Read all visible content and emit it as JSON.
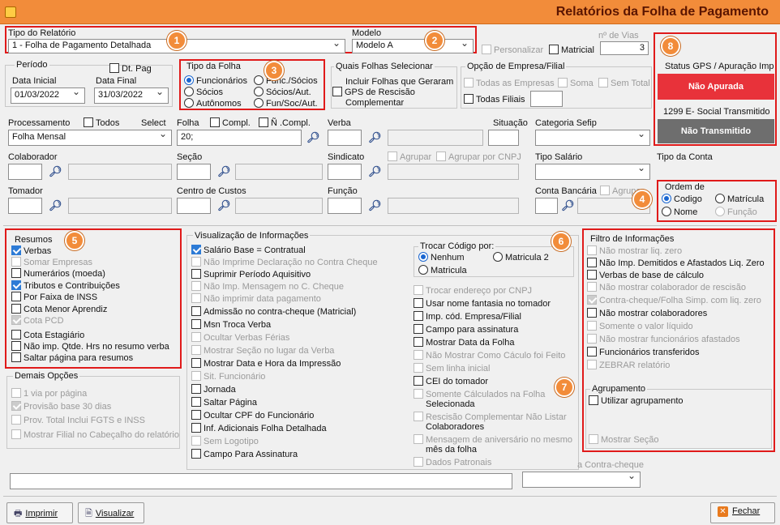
{
  "app": {
    "title": "Relatórios da Folha de Pagamento"
  },
  "tipo_relatorio": {
    "label": "Tipo do Relatório",
    "value": "1 - Folha de Pagamento Detalhada"
  },
  "modelo": {
    "label": "Modelo",
    "value": "Modelo A"
  },
  "personalizar": "Personalizar",
  "matricial": "Matricial",
  "vias": {
    "label": "nº de Vias",
    "value": "3"
  },
  "periodo": {
    "label": "Período",
    "dt_pag": "Dt. Pag",
    "data_inicial_label": "Data Inicial",
    "data_final_label": "Data Final",
    "data_inicial": "01/03/2022",
    "data_final": "31/03/2022"
  },
  "tipo_folha": {
    "label": "Tipo da Folha",
    "options": [
      "Funcionários",
      "Func./Sócios",
      "Sócios",
      "Sócios/Aut.",
      "Autônomos",
      "Fun/Soc/Aut."
    ]
  },
  "quais_folhas": {
    "label": "Quais Folhas Selecionar",
    "incluir": "Incluir Folhas que Geraram",
    "gps": "GPS de Rescisão",
    "complementar": "Complementar"
  },
  "opcao_empresa": {
    "label": "Opção de Empresa/Filial",
    "todas_empresas": "Todas as Empresas",
    "soma": "Soma",
    "sem_total": "Sem Total",
    "todas_filiais": "Todas Filiais"
  },
  "status": {
    "gps_label": "Status GPS / Apuração Imp",
    "gps_value": "Não Apurada",
    "esocial_label": "1299 E- Social Transmitido",
    "esocial_value": "Não Transmitido",
    "gps_color": "#e8323a",
    "esocial_color": "#6e6e6e"
  },
  "processamento": {
    "label": "Processamento",
    "todos": "Todos",
    "select": "Select",
    "value": "Folha Mensal"
  },
  "folha": {
    "label": "Folha",
    "compl": "Compl.",
    "n_compl": "Ñ .Compl.",
    "value": "20;"
  },
  "verba_label": "Verba",
  "situacao_label": "Situação",
  "categoria_sefip_label": "Categoria Sefip",
  "colaborador_label": "Colaborador",
  "secao_label": "Seção",
  "sindicato_label": "Sindicato",
  "agrupar": "Agrupar",
  "agrupar_cnpj": "Agrupar por CNPJ",
  "tipo_salario_label": "Tipo Salário",
  "tipo_conta_label": "Tipo da Conta",
  "tomador_label": "Tomador",
  "centro_custos_label": "Centro de Custos",
  "funcao_label": "Função",
  "conta_bancaria_label": "Conta Bancária",
  "agrupar2": "Agrupar",
  "ordem": {
    "label": "Ordem de",
    "codigo": "Codigo",
    "matricula": "Matrícula",
    "nome": "Nome",
    "funcao": "Função"
  },
  "resumos": {
    "label": "Resumos",
    "items": [
      "Verbas",
      "Somar Empresas",
      "Numerários (moeda)",
      "Tributos e Contribuições",
      "Por Faixa de INSS",
      "Cota Menor Aprendiz",
      "Cota PCD",
      "Cota Estagiário",
      "Não imp. Qtde. Hrs no resumo verba",
      "Saltar página para resumos"
    ]
  },
  "demais": {
    "label": "Demais Opções",
    "items": [
      "1 via por página",
      "Provisão base 30 dias",
      "Prov. Total Inclui FGTS e INSS",
      "Mostrar Filial no Cabeçalho do relatório"
    ]
  },
  "visualizacao": {
    "label": "Visualização de Informações",
    "items": [
      "Salário Base = Contratual",
      "Não Imprime Declaração no Contra Cheque",
      "Suprimir Período Aquisitivo",
      "Não Imp. Mensagem no C. Cheque",
      "Não imprimir data pagamento",
      "Admissão no contra-cheque (Matricial)",
      "Msn Troca Verba",
      "Ocultar Verbas Férias",
      "Mostrar Seção no lugar da Verba",
      "Mostrar Data e Hora da Impressão",
      "Sit. Funcionário",
      "Jornada",
      "Saltar Página",
      "Ocultar CPF do Funcionário",
      "Inf. Adicionais Folha Detalhada",
      "Sem Logotipo",
      "Campo Para Assinatura"
    ]
  },
  "trocar": {
    "label": "Trocar Código por:",
    "nenhum": "Nenhum",
    "matricula2": "Matricula 2",
    "matricula": "Matricula"
  },
  "col2": {
    "items": [
      "Trocar endereço por CNPJ",
      "Usar nome fantasia no tomador",
      "Imp. cód. Empresa/Filial",
      "Campo para assinatura",
      "Mostrar Data da Folha",
      "Não Mostrar Como Cáculo foi Feito",
      "Sem linha inicial",
      "CEI do tomador",
      "Somente Cálculados na Folha",
      "Selecionada",
      "Rescisão Complementar Não Listar",
      "Colaboradores",
      "Mensagem de aniversário no mesmo",
      "mês da folha",
      "Dados Patronais"
    ]
  },
  "filtro": {
    "label": "Filtro de Informações",
    "items": [
      "Não mostrar liq. zero",
      "Não Imp. Demitidos e Afastados Liq. Zero",
      "Verbas de base de cálculo",
      "Não mostrar colaborador de rescisão",
      "Contra-cheque/Folha Simp. com liq. zero",
      "Não mostrar colaboradores",
      "Somente o valor líquido",
      "Não mostrar funcionários afastados",
      "Funcionários transferidos",
      "ZEBRAR relatório"
    ]
  },
  "agrupamento": {
    "label": "Agrupamento",
    "utilizar": "Utilizar agrupamento",
    "mostrar_secao": "Mostrar Seção"
  },
  "contra_cheque_label": "a Contra-cheque",
  "buttons": {
    "imprimir": "Imprimir",
    "visualizar": "Visualizar",
    "fechar": "Fechar"
  },
  "badges": [
    "1",
    "2",
    "3",
    "4",
    "5",
    "6",
    "7",
    "8"
  ]
}
